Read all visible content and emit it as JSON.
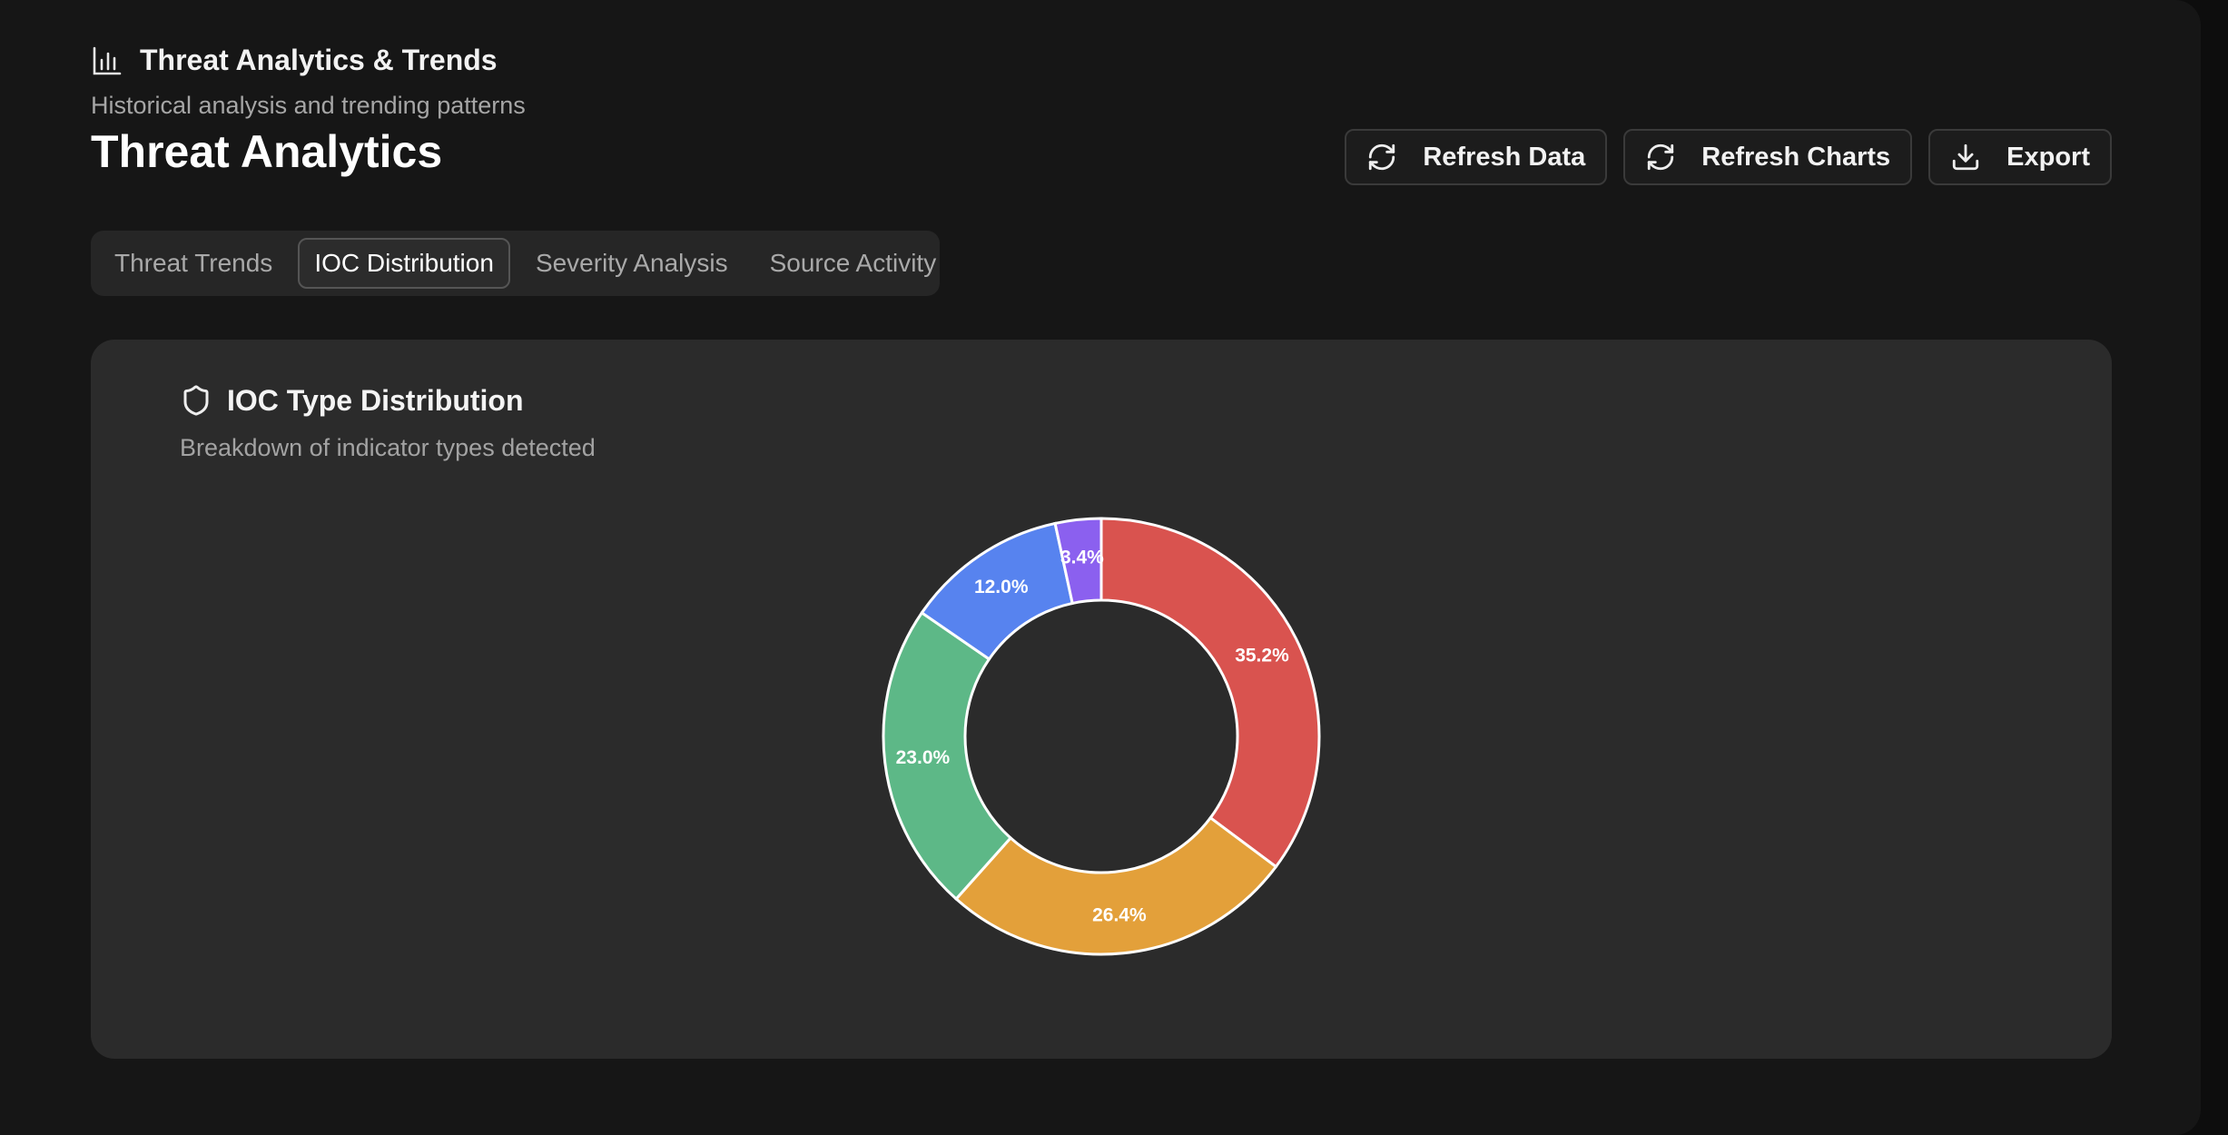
{
  "app": {
    "title": "Threat Analytics & Trends",
    "subtitle": "Historical analysis and trending patterns",
    "page_title": "Threat Analytics"
  },
  "toolbar": {
    "refresh_data_label": "Refresh Data",
    "refresh_charts_label": "Refresh Charts",
    "export_label": "Export"
  },
  "tabs": [
    {
      "label": "Threat Trends",
      "active": false
    },
    {
      "label": "IOC Distribution",
      "active": true
    },
    {
      "label": "Severity Analysis",
      "active": false
    },
    {
      "label": "Source Activity",
      "active": false
    }
  ],
  "card": {
    "title": "IOC Type Distribution",
    "subtitle": "Breakdown of indicator types detected",
    "icon": "shield-icon"
  },
  "colors": {
    "background": "#161616",
    "card": "#2b2b2b",
    "slice_border": "#ffffff"
  },
  "chart_data": {
    "type": "pie",
    "donut": true,
    "slices": [
      {
        "value": 35.2,
        "label": "35.2%",
        "color": "#d9534f"
      },
      {
        "value": 26.4,
        "label": "26.4%",
        "color": "#e3a03a"
      },
      {
        "value": 23.0,
        "label": "23.0%",
        "color": "#5db887"
      },
      {
        "value": 12.0,
        "label": "12.0%",
        "color": "#5783ef"
      },
      {
        "value": 3.4,
        "label": "3.4%",
        "color": "#8b60ef"
      }
    ]
  }
}
